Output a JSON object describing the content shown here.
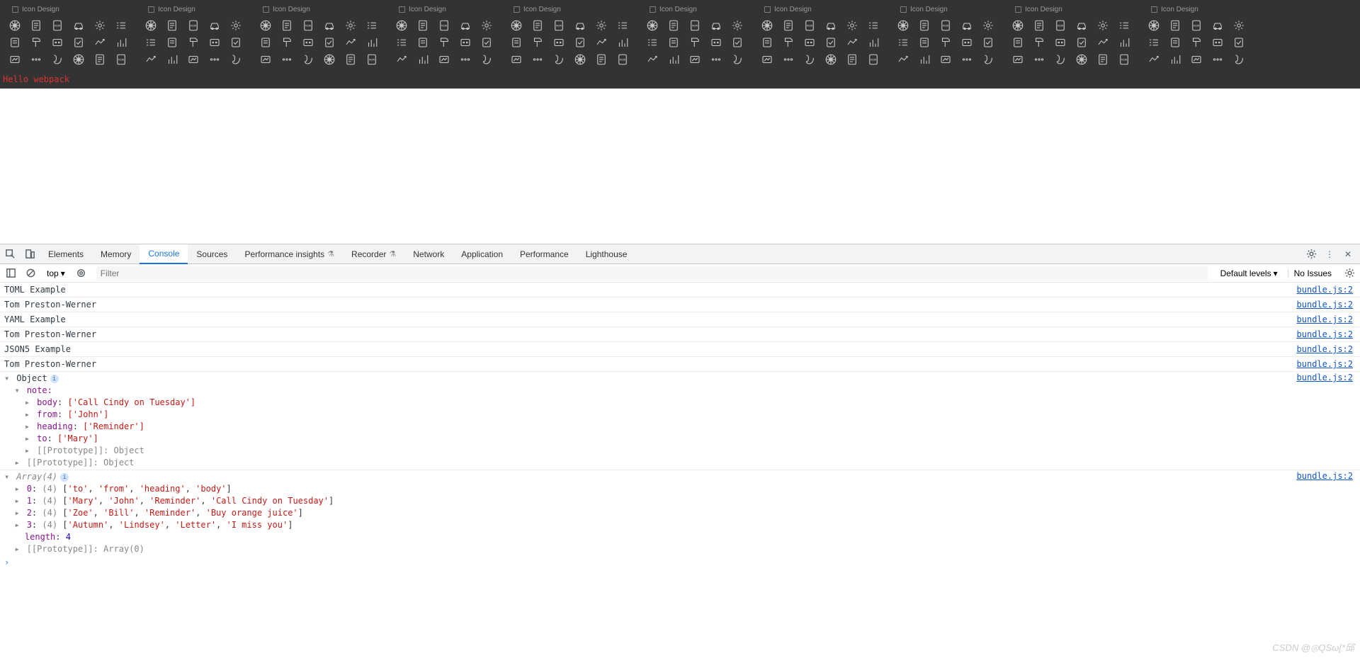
{
  "top": {
    "set_label": "Icon Design",
    "num_sets": 10,
    "rows": 3,
    "cols": 6,
    "narrow_cols": 5,
    "hello_text": "Hello webpack"
  },
  "devtools": {
    "tabs": [
      "Elements",
      "Memory",
      "Console",
      "Sources",
      "Performance insights",
      "Recorder",
      "Network",
      "Application",
      "Performance",
      "Lighthouse"
    ],
    "active_tab": "Console",
    "flask_tabs": [
      "Performance insights",
      "Recorder"
    ],
    "toolbar": {
      "context": "top",
      "filter_placeholder": "Filter",
      "levels": "Default levels",
      "issues": "No Issues"
    },
    "source_link": "bundle.js:2",
    "logs_plain": [
      "TOML Example",
      "Tom Preston-Werner",
      "YAML Example",
      "Tom Preston-Werner",
      "JSON5 Example",
      "Tom Preston-Werner"
    ],
    "object_log": {
      "header": "Object",
      "note_key": "note:",
      "entries": [
        {
          "k": "body",
          "v": "['Call Cindy on Tuesday']"
        },
        {
          "k": "from",
          "v": "['John']"
        },
        {
          "k": "heading",
          "v": "['Reminder']"
        },
        {
          "k": "to",
          "v": "['Mary']"
        }
      ],
      "proto_inner": "[[Prototype]]: Object",
      "proto_outer": "[[Prototype]]: Object"
    },
    "array_log": {
      "header": "Array(4)",
      "rows": [
        {
          "idx": "0",
          "len": "(4)",
          "vals": [
            "'to'",
            "'from'",
            "'heading'",
            "'body'"
          ]
        },
        {
          "idx": "1",
          "len": "(4)",
          "vals": [
            "'Mary'",
            "'John'",
            "'Reminder'",
            "'Call Cindy on Tuesday'"
          ]
        },
        {
          "idx": "2",
          "len": "(4)",
          "vals": [
            "'Zoe'",
            "'Bill'",
            "'Reminder'",
            "'Buy orange juice'"
          ]
        },
        {
          "idx": "3",
          "len": "(4)",
          "vals": [
            "'Autumn'",
            "'Lindsey'",
            "'Letter'",
            "'I miss you'"
          ]
        }
      ],
      "length_label": "length",
      "length_val": "4",
      "proto": "[[Prototype]]: Array(0)"
    }
  },
  "watermark": "CSDN @◎QSω[*邱"
}
